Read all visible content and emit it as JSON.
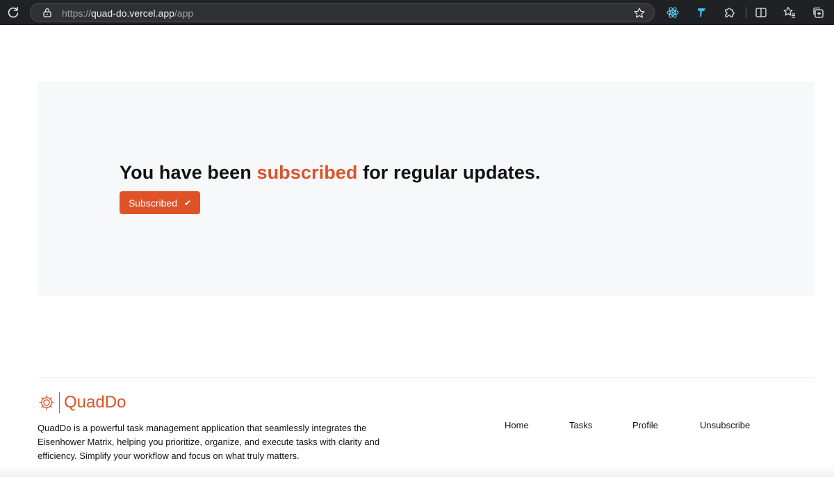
{
  "browser": {
    "url_protocol": "https://",
    "url_host": "quad-do.vercel.app",
    "url_path": "/app",
    "icons": [
      "reload-icon",
      "lock-icon",
      "star-icon",
      "react-devtools-icon",
      "tailwind-extension-icon",
      "extensions-icon",
      "split-screen-icon",
      "favorites-icon",
      "collections-icon"
    ]
  },
  "hero": {
    "headline_before": "You have been ",
    "headline_accent": "subscribed",
    "headline_after": " for regular updates.",
    "button_label": "Subscribed",
    "button_check": "✔"
  },
  "footer": {
    "brand": "QuadDo",
    "description": "QuadDo is a powerful task management application that seamlessly integrates the Eisenhower Matrix, helping you prioritize, organize, and execute tasks with clarity and efficiency. Simplify your workflow and focus on what truly matters.",
    "links": [
      "Home",
      "Tasks",
      "Profile",
      "Unsubscribe"
    ]
  },
  "colors": {
    "accent": "#d9542b",
    "button": "#df5228",
    "hero_bg": "#f7f8fa",
    "chrome_bg": "#202124"
  }
}
